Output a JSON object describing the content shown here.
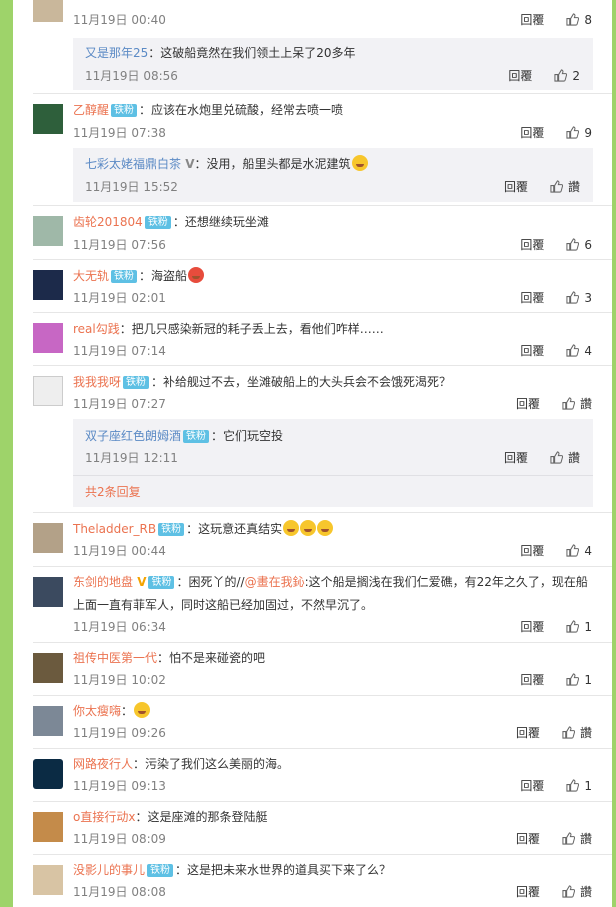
{
  "reply_label": "回覆",
  "like_label": "讚",
  "comments": [
    {
      "name": "",
      "text": "",
      "time": "11月19日 00:40",
      "likes": "8"
    },
    {
      "name": "又是那年25",
      "text": "：这破船竟然在我们领土上呆了20多年",
      "time": "11月19日 08:56",
      "likes": "2"
    },
    {
      "name": "乙醇醒",
      "badge": "铁粉",
      "text": "：应该在水炮里兑硫酸，经常去喷一喷",
      "time": "11月19日 07:38",
      "likes": "9"
    },
    {
      "name": "七彩太姥福鼎白茶",
      "text": "：没用，船里头都是水泥建筑",
      "time": "11月19日 15:52",
      "likes": "讚"
    },
    {
      "name": "齿轮201804",
      "badge": "铁粉",
      "text": "：还想继续玩坐滩",
      "time": "11月19日 07:56",
      "likes": "6"
    },
    {
      "name": "大无轨",
      "badge": "铁粉",
      "text": "：海盗船",
      "time": "11月19日 02:01",
      "likes": "3"
    },
    {
      "name": "real勾践",
      "text": "：把几只感染新冠的耗子丢上去，看他们咋样……",
      "time": "11月19日 07:14",
      "likes": "4"
    },
    {
      "name": "我我我呀",
      "badge": "铁粉",
      "text": "：补给舰过不去，坐滩破船上的大头兵会不会饿死渴死？",
      "time": "11月19日 07:27",
      "likes": "讚"
    },
    {
      "name": "双子座红色朗姆酒",
      "badge": "铁粉",
      "text": "：它们玩空投",
      "time": "11月19日 12:11",
      "likes": "讚"
    },
    {
      "more": "共2条回复"
    },
    {
      "name": "Theladder_RB",
      "badge": "铁粉",
      "text": "：这玩意还真结实",
      "time": "11月19日 00:44",
      "likes": "4"
    },
    {
      "name": "东剑的地盘",
      "badge": "铁粉",
      "text1": "：困死丫的//",
      "mention": "@畫在我鈊",
      "text2": ":这个船是搁浅在我们仁爱礁，有22年之久了，现在船",
      "text3": "上面一直有菲军人，同时这船已经加固过，不然早沉了。",
      "time": "11月19日 06:34",
      "likes": "1"
    },
    {
      "name": "祖传中医第一代",
      "text": "：怕不是来碰瓷的吧",
      "time": "11月19日 10:02",
      "likes": "1"
    },
    {
      "name": "你太瘦嗨",
      "text": "：",
      "time": "11月19日 09:26",
      "likes": "讚"
    },
    {
      "name": "网路夜行人",
      "text": "：污染了我们这么美丽的海。",
      "time": "11月19日 09:13",
      "likes": "1"
    },
    {
      "name": "o直接行动x",
      "text": "：这是座滩的那条登陆艇",
      "time": "11月19日 08:09",
      "likes": "讚"
    },
    {
      "name": "没影儿的事儿",
      "badge": "铁粉",
      "text": "：这是把未来水世界的道具买下来了么？",
      "time": "11月19日 08:08",
      "likes": "讚"
    }
  ]
}
